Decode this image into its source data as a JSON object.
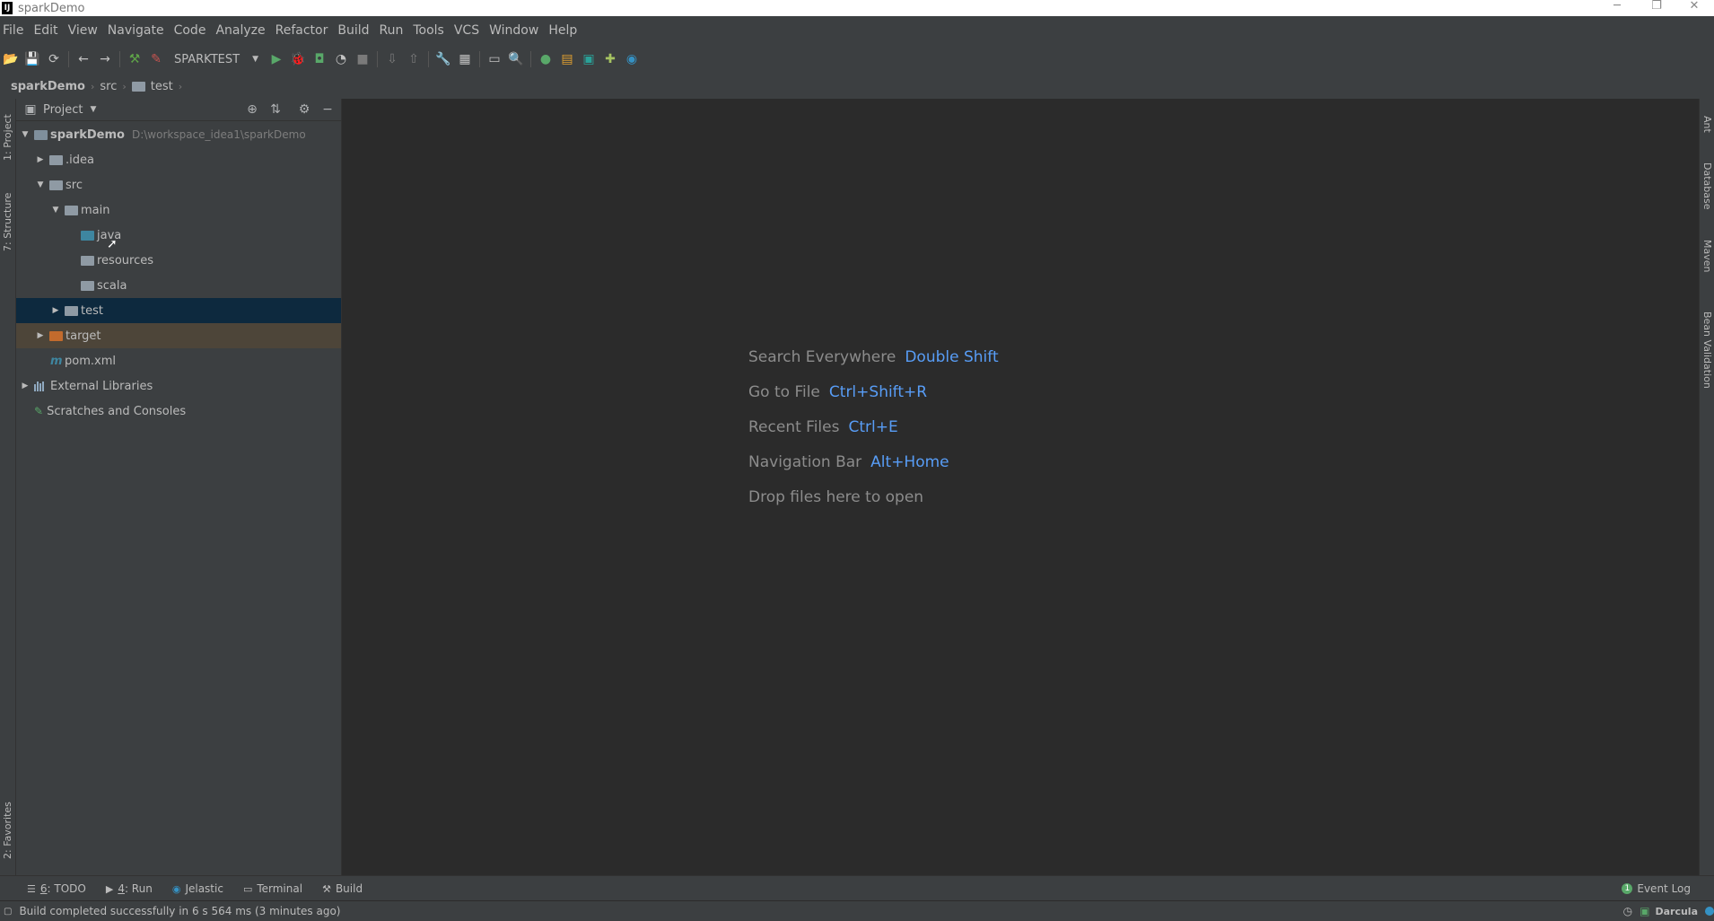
{
  "window": {
    "title": "sparkDemo",
    "minimize": "─",
    "restore": "❐",
    "close": "✕"
  },
  "menu": [
    "File",
    "Edit",
    "View",
    "Navigate",
    "Code",
    "Analyze",
    "Refactor",
    "Build",
    "Run",
    "Tools",
    "VCS",
    "Window",
    "Help"
  ],
  "toolbar": {
    "run_config": "SPARKTEST"
  },
  "breadcrumb": {
    "project": "sparkDemo",
    "src": "src",
    "test": "test"
  },
  "left_tabs": {
    "project": "1: Project",
    "structure": "7: Structure",
    "favorites": "2: Favorites"
  },
  "right_tabs": {
    "ant": "Ant",
    "database": "Database",
    "maven": "Maven",
    "bean_validation": "Bean Validation"
  },
  "project_panel": {
    "title": "Project",
    "tree": {
      "root_name": "sparkDemo",
      "root_path": "D:\\workspace_idea1\\sparkDemo",
      "idea": ".idea",
      "src": "src",
      "main": "main",
      "java": "java",
      "resources": "resources",
      "scala": "scala",
      "test": "test",
      "target": "target",
      "pom": "pom.xml",
      "external_libraries": "External Libraries",
      "scratches": "Scratches and Consoles"
    }
  },
  "editor_hints": [
    {
      "label": "Search Everywhere",
      "key": "Double Shift"
    },
    {
      "label": "Go to File",
      "key": "Ctrl+Shift+R"
    },
    {
      "label": "Recent Files",
      "key": "Ctrl+E"
    },
    {
      "label": "Navigation Bar",
      "key": "Alt+Home"
    },
    {
      "label": "Drop files here to open",
      "key": ""
    }
  ],
  "tool_windows": {
    "todo_num": "6",
    "todo_label": ": TODO",
    "run_num": "4",
    "run_label": ": Run",
    "jelastic": "Jelastic",
    "terminal": "Terminal",
    "build": "Build",
    "event_log": "Event Log",
    "event_log_count": "1"
  },
  "status": {
    "message": "Build completed successfully in 6 s 564 ms (3 minutes ago)",
    "theme": "Darcula"
  },
  "colors": {
    "accent_blue": "#589df6",
    "selection": "#0d293e",
    "excluded": "#4d4539",
    "panel_bg": "#3c3f41",
    "editor_bg": "#2b2b2b"
  }
}
